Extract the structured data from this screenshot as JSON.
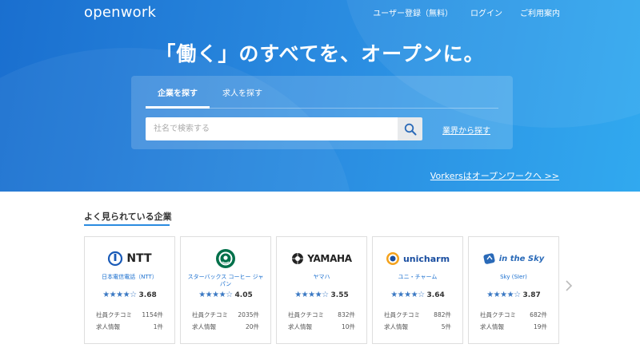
{
  "brand": {
    "logo_text": "openwork"
  },
  "nav": {
    "items": [
      "ユーザー登録（無料）",
      "ログイン",
      "ご利用案内"
    ]
  },
  "hero": {
    "headline": "「働く」のすべてを、オープンに。",
    "tabs": [
      "企業を探す",
      "求人を探す"
    ],
    "active_tab": 0,
    "search_placeholder": "社名で検索する",
    "industry_link": "業界から探す",
    "vorkers_link": "Vorkersはオープンワークへ >>"
  },
  "popular": {
    "title": "よく見られている企業",
    "companies": [
      {
        "logo_text": "NTT",
        "logo_icon": "ntt-logo-icon",
        "name": "日本電信電話（NTT）",
        "stars": "★★★★☆",
        "score": "3.68",
        "review_label": "社員クチコミ",
        "review_count": "1154件",
        "jobs_label": "求人情報",
        "jobs_count": "1件"
      },
      {
        "logo_text": "",
        "logo_icon": "starbucks-logo-icon",
        "name": "スターバックス コーヒー ジャパン",
        "stars": "★★★★☆",
        "score": "4.05",
        "review_label": "社員クチコミ",
        "review_count": "2035件",
        "jobs_label": "求人情報",
        "jobs_count": "20件"
      },
      {
        "logo_text": "YAMAHA",
        "logo_icon": "yamaha-logo-icon",
        "name": "ヤマハ",
        "stars": "★★★★☆",
        "score": "3.55",
        "review_label": "社員クチコミ",
        "review_count": "832件",
        "jobs_label": "求人情報",
        "jobs_count": "10件"
      },
      {
        "logo_text": "unicharm",
        "logo_icon": "unicharm-logo-icon",
        "name": "ユニ・チャーム",
        "stars": "★★★★☆",
        "score": "3.64",
        "review_label": "社員クチコミ",
        "review_count": "882件",
        "jobs_label": "求人情報",
        "jobs_count": "5件"
      },
      {
        "logo_text": "in the Sky",
        "logo_icon": "inthesky-logo-icon",
        "name": "Sky (SIer)",
        "stars": "★★★★☆",
        "score": "3.87",
        "review_label": "社員クチコミ",
        "review_count": "682件",
        "jobs_label": "求人情報",
        "jobs_count": "19件"
      }
    ]
  },
  "colors": {
    "hero_start": "#1a6fcf",
    "hero_end": "#31a9ef",
    "accent": "#2a8be0",
    "star": "#3a78c3"
  },
  "icons": {
    "search": "search-icon",
    "next": "chevron-right-icon"
  }
}
